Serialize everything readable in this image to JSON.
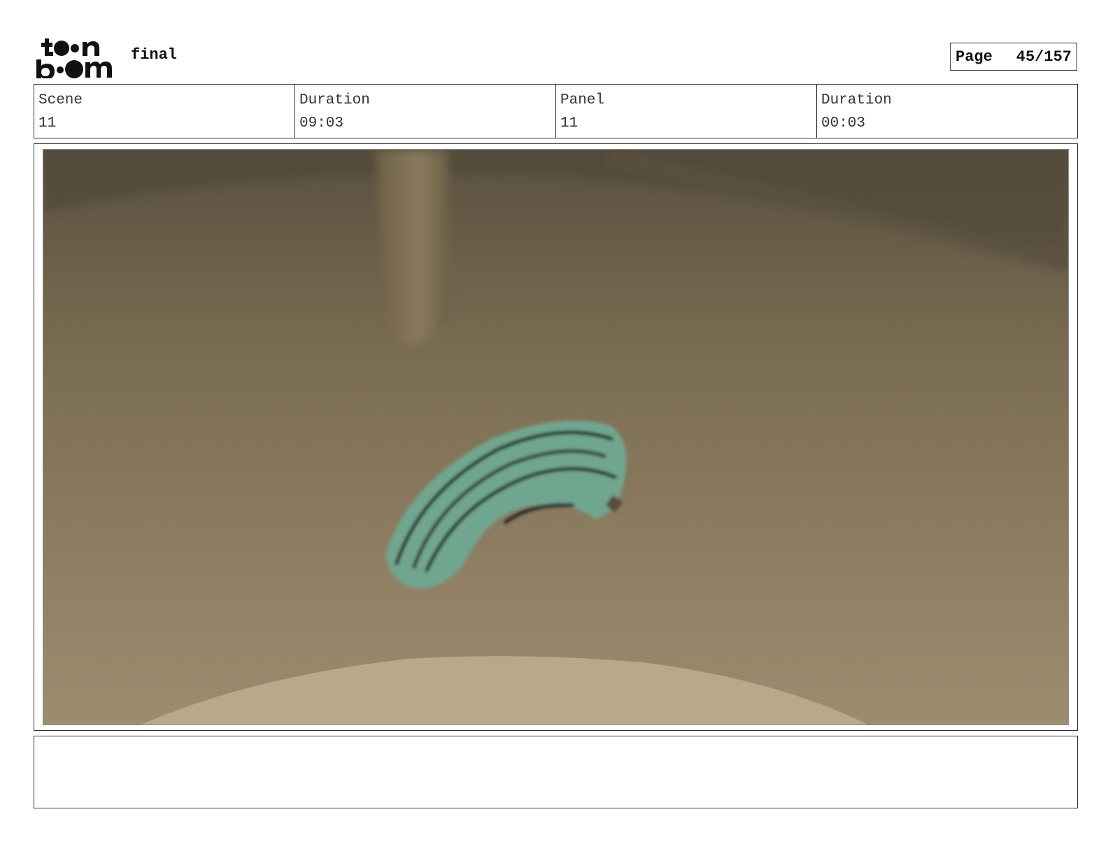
{
  "header": {
    "logo_text": "toon boom",
    "project_title": "final",
    "page_label": "Page",
    "page_number": "45/157"
  },
  "info": {
    "scene_label": "Scene",
    "scene_value": "11",
    "scene_duration_label": "Duration",
    "scene_duration_value": "09:03",
    "panel_label": "Panel",
    "panel_value": "11",
    "panel_duration_label": "Duration",
    "panel_duration_value": "00:03"
  },
  "notes": {
    "text": ""
  },
  "colors": {
    "wall": "#6b5e49",
    "floor": "#9a8a6c",
    "foreground": "#b9a88a",
    "object": "#6fa68f",
    "frame_border": "#333333"
  }
}
